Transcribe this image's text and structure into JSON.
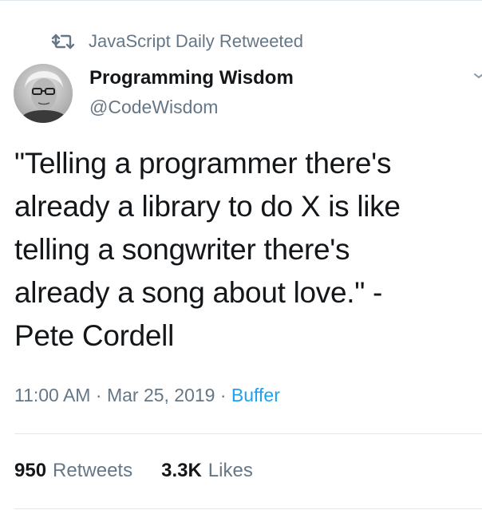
{
  "retweet_header": {
    "icon": "retweet-icon",
    "text": "JavaScript Daily Retweeted"
  },
  "author": {
    "avatar": "avatar-photo-elderly-man-glasses",
    "name": "Programming Wisdom",
    "handle": "@CodeWisdom"
  },
  "menu_icon": "chevron-down-icon",
  "tweet": {
    "lines": [
      "\"Telling a programmer there's",
      "already a library to do X is like",
      "telling a songwriter there's",
      "already a song about love.\" -",
      "Pete Cordell"
    ]
  },
  "meta": {
    "time": "11:00 AM",
    "separator": " · ",
    "date": "Mar 25, 2019",
    "source": "Buffer"
  },
  "stats": {
    "retweets_count": "950",
    "retweets_label": "Retweets",
    "likes_count": "3.3K",
    "likes_label": "Likes"
  },
  "colors": {
    "text": "#14171a",
    "muted": "#657786",
    "link": "#1da1f2",
    "divider": "#e1e8ed"
  }
}
